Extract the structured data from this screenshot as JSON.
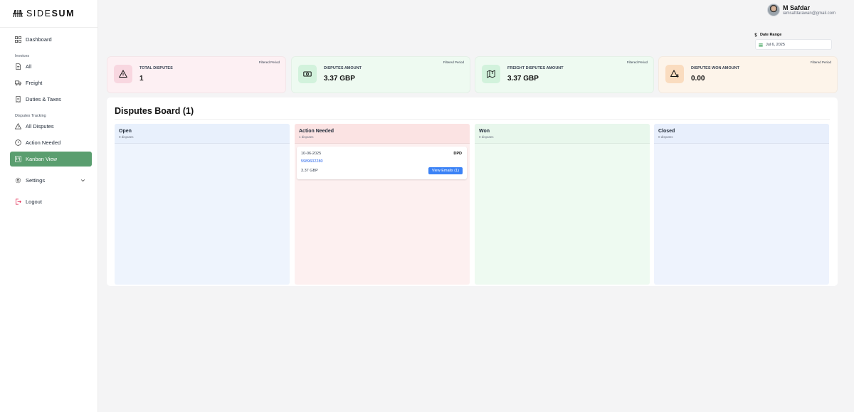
{
  "brand": {
    "light": "SIDE",
    "bold": "SUM",
    "icon": "brand-bars-icon"
  },
  "user": {
    "name": "M Safdar",
    "email": "iamsafdarawan@gmail.com"
  },
  "date_range": {
    "label": "Date Range",
    "value": "Jul 6, 2025"
  },
  "sidebar": {
    "dashboard": "Dashboard",
    "invoices_section": "Invoices",
    "all": "All",
    "freight": "Freight",
    "duties": "Duties & Taxes",
    "disputes_section": "Disputes Tracking",
    "all_disputes": "All Disputes",
    "action_needed": "Action Needed",
    "kanban": "Kanban View",
    "settings": "Settings",
    "logout": "Logout"
  },
  "cards": [
    {
      "title": "TOTAL DISPUTES",
      "value": "1",
      "tag": "Filtered Period",
      "icon": "warning-icon",
      "bg": "#fdf0f3",
      "icon_bg": "#f8d7e0"
    },
    {
      "title": "DISPUTES AMOUNT",
      "value": "3.37 GBP",
      "tag": "Filtered Period",
      "icon": "banknote-icon",
      "bg": "#eefaf1",
      "icon_bg": "#d2f2dc"
    },
    {
      "title": "FREIGHT DISPUTES AMOUNT",
      "value": "3.37 GBP",
      "tag": "Filtered Period",
      "icon": "map-currency-icon",
      "bg": "#eefaf1",
      "icon_bg": "#d2f2dc"
    },
    {
      "title": "DISPUTES WON AMOUNT",
      "value": "0.00",
      "tag": "Filtered Period",
      "icon": "warning-dollar-icon",
      "bg": "#fdf4ea",
      "icon_bg": "#fadcbf"
    }
  ],
  "board": {
    "title": "Disputes Board (1)",
    "columns": [
      {
        "title": "Open",
        "count": "0 disputes",
        "bg": "#eef4fd",
        "head_bg": "#e8f0fc"
      },
      {
        "title": "Action Needed",
        "count": "1 disputes",
        "bg": "#fdf0f0",
        "head_bg": "#fbe3e3"
      },
      {
        "title": "Won",
        "count": "0 disputes",
        "bg": "#eefaf1",
        "head_bg": "#e8f7ec"
      },
      {
        "title": "Closed",
        "count": "0 disputes",
        "bg": "#eef3fd",
        "head_bg": "#e8effc"
      }
    ],
    "dispute": {
      "date": "10-06-2025",
      "carrier": "DPD",
      "invoice": "5989602280",
      "amount": "3.37 GBP",
      "button": "View Emails (1)"
    }
  }
}
